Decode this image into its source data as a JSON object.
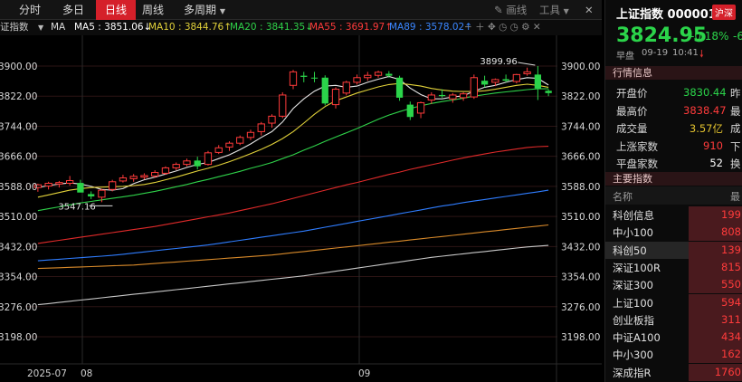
{
  "toolbar": {
    "tabs": [
      {
        "label": "分时",
        "active": false
      },
      {
        "label": "多日",
        "active": false
      },
      {
        "label": "日线",
        "active": true
      },
      {
        "label": "周线",
        "active": false
      },
      {
        "label": "多周期",
        "active": false
      }
    ],
    "draw_label": "画线",
    "tools_label": "工具",
    "close_glyph": "✕"
  },
  "ma_bar": {
    "title": "证指数",
    "ma_label": "MA",
    "items": [
      {
        "text": "MA5 : 3851.06↓",
        "color": "#ffffff"
      },
      {
        "text": "MA10 : 3844.76↑",
        "color": "#e2d23a"
      },
      {
        "text": "MA20 : 3841.35↓",
        "color": "#2fd34a"
      },
      {
        "text": "MA55 : 3691.97↑",
        "color": "#ff3b3b"
      },
      {
        "text": "MA89 : 3578.02↑",
        "color": "#3a86ff"
      }
    ]
  },
  "colors": {
    "up": "#ff3b3b",
    "down": "#2bd44a",
    "ma5": "#e6e6e6",
    "ma10": "#e2d23a",
    "ma20": "#2fd34a",
    "ma55": "#e02a2a",
    "ma89": "#2f7dff",
    "ma120": "#d98a2a",
    "ma250": "#c8c8c8"
  },
  "chart_data": {
    "type": "candlestick",
    "y_ticks": [
      "3900.00",
      "3822.00",
      "3744.00",
      "3666.00",
      "3588.00",
      "3510.00",
      "3432.00",
      "3354.00",
      "3276.00",
      "3198.00"
    ],
    "y_tick_values": [
      3900,
      3822,
      3744,
      3666,
      3588,
      3510,
      3432,
      3354,
      3276,
      3198
    ],
    "x_labels": [
      "2025-07",
      "08",
      "09"
    ],
    "annotations": [
      {
        "text": "3899.96",
        "kind": "high"
      },
      {
        "text": "3547.16",
        "kind": "low"
      }
    ],
    "candles": [
      {
        "o": 3585,
        "h": 3595,
        "l": 3574,
        "c": 3592
      },
      {
        "o": 3589,
        "h": 3600,
        "l": 3580,
        "c": 3596
      },
      {
        "o": 3594,
        "h": 3602,
        "l": 3585,
        "c": 3598
      },
      {
        "o": 3596,
        "h": 3615,
        "l": 3590,
        "c": 3603
      },
      {
        "o": 3597,
        "h": 3605,
        "l": 3575,
        "c": 3572
      },
      {
        "o": 3568,
        "h": 3575,
        "l": 3555,
        "c": 3562
      },
      {
        "o": 3560,
        "h": 3582,
        "l": 3547,
        "c": 3578
      },
      {
        "o": 3580,
        "h": 3605,
        "l": 3575,
        "c": 3600
      },
      {
        "o": 3602,
        "h": 3618,
        "l": 3598,
        "c": 3610
      },
      {
        "o": 3608,
        "h": 3620,
        "l": 3600,
        "c": 3614
      },
      {
        "o": 3612,
        "h": 3622,
        "l": 3606,
        "c": 3616
      },
      {
        "o": 3615,
        "h": 3630,
        "l": 3610,
        "c": 3624
      },
      {
        "o": 3622,
        "h": 3640,
        "l": 3618,
        "c": 3636
      },
      {
        "o": 3636,
        "h": 3650,
        "l": 3630,
        "c": 3645
      },
      {
        "o": 3645,
        "h": 3660,
        "l": 3640,
        "c": 3654
      },
      {
        "o": 3655,
        "h": 3665,
        "l": 3632,
        "c": 3640
      },
      {
        "o": 3645,
        "h": 3680,
        "l": 3642,
        "c": 3675
      },
      {
        "o": 3676,
        "h": 3695,
        "l": 3672,
        "c": 3688
      },
      {
        "o": 3690,
        "h": 3705,
        "l": 3680,
        "c": 3700
      },
      {
        "o": 3700,
        "h": 3720,
        "l": 3695,
        "c": 3715
      },
      {
        "o": 3715,
        "h": 3735,
        "l": 3708,
        "c": 3728
      },
      {
        "o": 3730,
        "h": 3755,
        "l": 3720,
        "c": 3750
      },
      {
        "o": 3752,
        "h": 3775,
        "l": 3740,
        "c": 3770
      },
      {
        "o": 3770,
        "h": 3832,
        "l": 3765,
        "c": 3825
      },
      {
        "o": 3850,
        "h": 3890,
        "l": 3840,
        "c": 3885
      },
      {
        "o": 3875,
        "h": 3885,
        "l": 3858,
        "c": 3872
      },
      {
        "o": 3870,
        "h": 3885,
        "l": 3858,
        "c": 3868
      },
      {
        "o": 3870,
        "h": 3876,
        "l": 3798,
        "c": 3803
      },
      {
        "o": 3800,
        "h": 3845,
        "l": 3790,
        "c": 3840
      },
      {
        "o": 3830,
        "h": 3862,
        "l": 3824,
        "c": 3858
      },
      {
        "o": 3858,
        "h": 3878,
        "l": 3852,
        "c": 3870
      },
      {
        "o": 3870,
        "h": 3885,
        "l": 3862,
        "c": 3876
      },
      {
        "o": 3876,
        "h": 3888,
        "l": 3870,
        "c": 3884
      },
      {
        "o": 3880,
        "h": 3887,
        "l": 3870,
        "c": 3875
      },
      {
        "o": 3870,
        "h": 3875,
        "l": 3810,
        "c": 3818
      },
      {
        "o": 3800,
        "h": 3808,
        "l": 3760,
        "c": 3768
      },
      {
        "o": 3778,
        "h": 3808,
        "l": 3765,
        "c": 3805
      },
      {
        "o": 3812,
        "h": 3832,
        "l": 3802,
        "c": 3825
      },
      {
        "o": 3825,
        "h": 3840,
        "l": 3818,
        "c": 3822
      },
      {
        "o": 3815,
        "h": 3830,
        "l": 3805,
        "c": 3825
      },
      {
        "o": 3818,
        "h": 3832,
        "l": 3810,
        "c": 3828
      },
      {
        "o": 3820,
        "h": 3878,
        "l": 3815,
        "c": 3870
      },
      {
        "o": 3862,
        "h": 3875,
        "l": 3845,
        "c": 3852
      },
      {
        "o": 3858,
        "h": 3868,
        "l": 3848,
        "c": 3865
      },
      {
        "o": 3866,
        "h": 3878,
        "l": 3858,
        "c": 3862
      },
      {
        "o": 3860,
        "h": 3880,
        "l": 3855,
        "c": 3878
      },
      {
        "o": 3880,
        "h": 3896,
        "l": 3875,
        "c": 3885
      },
      {
        "o": 3878,
        "h": 3900,
        "l": 3812,
        "c": 3842
      },
      {
        "o": 3836,
        "h": 3840,
        "l": 3822,
        "c": 3830
      }
    ],
    "ma_lines": [
      {
        "name": "MA5",
        "color_key": "ma5",
        "values": [
          3585,
          3590,
          3594,
          3597,
          3594,
          3588,
          3580,
          3578,
          3582,
          3595,
          3605,
          3612,
          3620,
          3628,
          3637,
          3645,
          3650,
          3660,
          3670,
          3683,
          3698,
          3715,
          3730,
          3755,
          3790,
          3815,
          3835,
          3848,
          3850,
          3845,
          3848,
          3858,
          3866,
          3873,
          3865,
          3843,
          3826,
          3815,
          3815,
          3820,
          3823,
          3835,
          3845,
          3850,
          3858,
          3865,
          3870,
          3868,
          3851
        ]
      },
      {
        "name": "MA10",
        "color_key": "ma10",
        "values": [
          3560,
          3566,
          3572,
          3578,
          3582,
          3585,
          3586,
          3587,
          3588,
          3590,
          3593,
          3598,
          3605,
          3612,
          3620,
          3628,
          3635,
          3643,
          3652,
          3662,
          3673,
          3684,
          3697,
          3712,
          3730,
          3752,
          3775,
          3795,
          3810,
          3820,
          3830,
          3838,
          3846,
          3852,
          3855,
          3852,
          3848,
          3842,
          3838,
          3835,
          3834,
          3834,
          3836,
          3840,
          3845,
          3850,
          3853,
          3850,
          3845
        ]
      },
      {
        "name": "MA20",
        "color_key": "ma20",
        "values": [
          3525,
          3530,
          3535,
          3540,
          3545,
          3549,
          3553,
          3557,
          3561,
          3565,
          3570,
          3575,
          3581,
          3587,
          3593,
          3600,
          3606,
          3613,
          3620,
          3627,
          3635,
          3642,
          3650,
          3660,
          3670,
          3682,
          3693,
          3705,
          3716,
          3727,
          3738,
          3750,
          3762,
          3773,
          3782,
          3790,
          3797,
          3803,
          3808,
          3812,
          3817,
          3822,
          3826,
          3830,
          3833,
          3836,
          3839,
          3841,
          3841
        ]
      },
      {
        "name": "MA55",
        "color_key": "ma55",
        "values": [
          3440,
          3444,
          3448,
          3452,
          3456,
          3460,
          3464,
          3468,
          3472,
          3476,
          3480,
          3484,
          3489,
          3494,
          3499,
          3504,
          3509,
          3514,
          3519,
          3525,
          3531,
          3537,
          3543,
          3550,
          3557,
          3564,
          3571,
          3578,
          3585,
          3592,
          3598,
          3605,
          3612,
          3619,
          3625,
          3632,
          3638,
          3644,
          3650,
          3656,
          3662,
          3667,
          3672,
          3677,
          3681,
          3685,
          3689,
          3691,
          3692
        ]
      },
      {
        "name": "MA89",
        "color_key": "ma89",
        "values": [
          3395,
          3397,
          3399,
          3401,
          3403,
          3405,
          3407,
          3409,
          3412,
          3415,
          3418,
          3421,
          3424,
          3427,
          3430,
          3433,
          3436,
          3440,
          3444,
          3448,
          3452,
          3456,
          3460,
          3464,
          3468,
          3472,
          3477,
          3482,
          3487,
          3492,
          3497,
          3502,
          3507,
          3512,
          3517,
          3522,
          3527,
          3532,
          3537,
          3541,
          3546,
          3550,
          3554,
          3558,
          3562,
          3566,
          3570,
          3574,
          3578
        ]
      },
      {
        "name": "MA120",
        "color_key": "ma120",
        "values": [
          3375,
          3376,
          3377,
          3378,
          3379,
          3380,
          3381,
          3382,
          3383,
          3384,
          3386,
          3388,
          3390,
          3392,
          3394,
          3396,
          3398,
          3400,
          3402,
          3404,
          3406,
          3408,
          3410,
          3413,
          3416,
          3419,
          3422,
          3425,
          3428,
          3431,
          3434,
          3437,
          3440,
          3443,
          3446,
          3449,
          3452,
          3455,
          3458,
          3461,
          3464,
          3467,
          3470,
          3473,
          3476,
          3479,
          3482,
          3485,
          3488
        ]
      },
      {
        "name": "MA250",
        "color_key": "ma250",
        "values": [
          3281,
          3284,
          3287,
          3290,
          3293,
          3296,
          3299,
          3302,
          3305,
          3308,
          3311,
          3314,
          3317,
          3320,
          3323,
          3326,
          3329,
          3332,
          3335,
          3338,
          3341,
          3344,
          3347,
          3350,
          3353,
          3356,
          3360,
          3364,
          3368,
          3372,
          3376,
          3380,
          3384,
          3388,
          3392,
          3396,
          3400,
          3404,
          3407,
          3410,
          3413,
          3416,
          3419,
          3422,
          3425,
          3428,
          3431,
          3433,
          3435
        ]
      }
    ]
  },
  "quote": {
    "title": "上证指数 000001",
    "market_badge": "沪深",
    "price": "3824.95",
    "change_pct": "-0.18%",
    "change_cut": "-6",
    "session": "早盘",
    "date": "09-19",
    "time": "10:41",
    "market_section": "行情信息",
    "rows": [
      {
        "label": "开盘价",
        "value": "3830.44",
        "color": "green",
        "cut": "昨"
      },
      {
        "label": "最高价",
        "value": "3838.47",
        "color": "red",
        "cut": "最"
      },
      {
        "label": "成交量",
        "value": "3.57亿",
        "color": "yellow",
        "cut": "成"
      },
      {
        "label": "上涨家数",
        "value": "910",
        "color": "red",
        "cut": "下"
      },
      {
        "label": "平盘家数",
        "value": "52",
        "color": "white",
        "cut": "换"
      }
    ]
  },
  "indices": {
    "section": "主要指数",
    "col_name": "名称",
    "col_value": "最",
    "items": [
      {
        "name": "科创信息",
        "value": "199"
      },
      {
        "name": "中小100",
        "value": "808"
      },
      {
        "name": "科创50",
        "value": "139"
      },
      {
        "name": "深证100R",
        "value": "815"
      },
      {
        "name": "深证300",
        "value": "550"
      },
      {
        "name": "上证100",
        "value": "594"
      },
      {
        "name": "创业板指",
        "value": "311"
      },
      {
        "name": "中证A100",
        "value": "434"
      },
      {
        "name": "中小300",
        "value": "162"
      },
      {
        "name": "深成指R",
        "value": "1760"
      }
    ]
  }
}
